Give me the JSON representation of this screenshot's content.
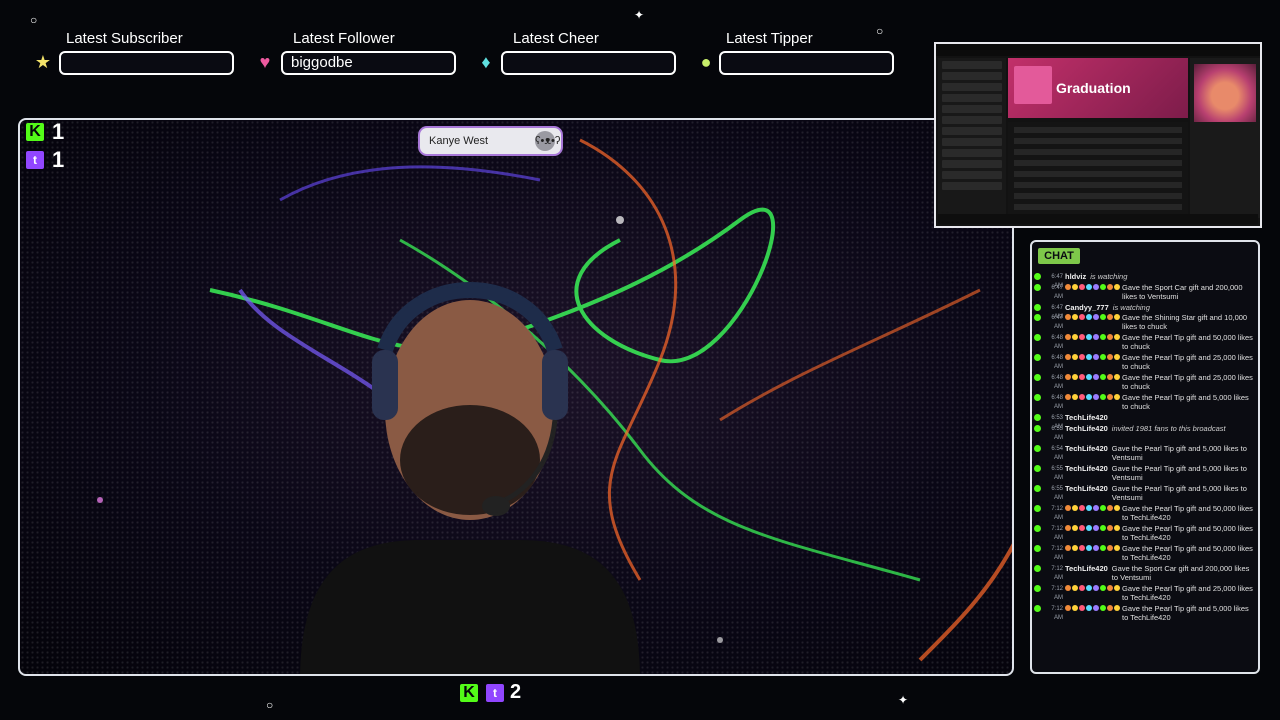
{
  "alerts": [
    {
      "label": "Latest Subscriber",
      "value": "",
      "icon": "star-icon",
      "color": "#f4e36a"
    },
    {
      "label": "Latest Follower",
      "value": "biggodbe",
      "icon": "heart-icon",
      "color": "#ee5aa0"
    },
    {
      "label": "Latest Cheer",
      "value": "",
      "icon": "gem-icon",
      "color": "#5fe0e0"
    },
    {
      "label": "Latest Tipper",
      "value": "",
      "icon": "coin-icon",
      "color": "#c8ee6a"
    }
  ],
  "counters": {
    "kick_top": "1",
    "twitch_top": "1",
    "bottom_total": "2",
    "kick_letter": "K",
    "twitch_letter": "t"
  },
  "now_playing": {
    "artist": "Kanye West",
    "icon": "bear-icon"
  },
  "spotify": {
    "album_title": "Graduation"
  },
  "chat": {
    "title": "CHAT",
    "messages": [
      {
        "time": "6:47 AM",
        "user": "hldviz",
        "text": "is watching",
        "watching": true
      },
      {
        "time": "6:47 AM",
        "user": "",
        "text": "Gave the Sport Car gift and 200,000 likes to Ventsumi",
        "watching": false
      },
      {
        "time": "6:47 AM",
        "user": "Candyy_777",
        "text": "is watching",
        "watching": true
      },
      {
        "time": "6:47 AM",
        "user": "",
        "text": "Gave the Shining Star gift and 10,000 likes to chuck",
        "watching": false
      },
      {
        "time": "6:48 AM",
        "user": "",
        "text": "Gave the Pearl Tip gift and 50,000 likes to chuck",
        "watching": false
      },
      {
        "time": "6:48 AM",
        "user": "",
        "text": "Gave the Pearl Tip gift and 25,000 likes to chuck",
        "watching": false
      },
      {
        "time": "6:48 AM",
        "user": "",
        "text": "Gave the Pearl Tip gift and 25,000 likes to chuck",
        "watching": false
      },
      {
        "time": "6:48 AM",
        "user": "",
        "text": "Gave the Pearl Tip gift and 5,000 likes to chuck",
        "watching": false
      },
      {
        "time": "6:53 AM",
        "user": "TechLife420",
        "text": "",
        "watching": false
      },
      {
        "time": "6:53 AM",
        "user": "TechLife420",
        "text": "invited 1981 fans to this broadcast",
        "watching": true
      },
      {
        "time": "6:54 AM",
        "user": "TechLife420",
        "text": "Gave the Pearl Tip gift and 5,000 likes to Ventsumi",
        "watching": false
      },
      {
        "time": "6:55 AM",
        "user": "TechLife420",
        "text": "Gave the Pearl Tip gift and 5,000 likes to Ventsumi",
        "watching": false
      },
      {
        "time": "6:55 AM",
        "user": "TechLife420",
        "text": "Gave the Pearl Tip gift and 5,000 likes to Ventsumi",
        "watching": false
      },
      {
        "time": "7:12 AM",
        "user": "",
        "text": "Gave the Pearl Tip gift and 50,000 likes to TechLife420",
        "watching": false
      },
      {
        "time": "7:12 AM",
        "user": "",
        "text": "Gave the Pearl Tip gift and 50,000 likes to TechLife420",
        "watching": false
      },
      {
        "time": "7:12 AM",
        "user": "",
        "text": "Gave the Pearl Tip gift and 50,000 likes to TechLife420",
        "watching": false
      },
      {
        "time": "7:12 AM",
        "user": "TechLife420",
        "text": "Gave the Sport Car gift and 200,000 likes to Ventsumi",
        "watching": false
      },
      {
        "time": "7:12 AM",
        "user": "",
        "text": "Gave the Pearl Tip gift and 25,000 likes to TechLife420",
        "watching": false
      },
      {
        "time": "7:12 AM",
        "user": "",
        "text": "Gave the Pearl Tip gift and 5,000 likes to TechLife420",
        "watching": false
      }
    ]
  }
}
